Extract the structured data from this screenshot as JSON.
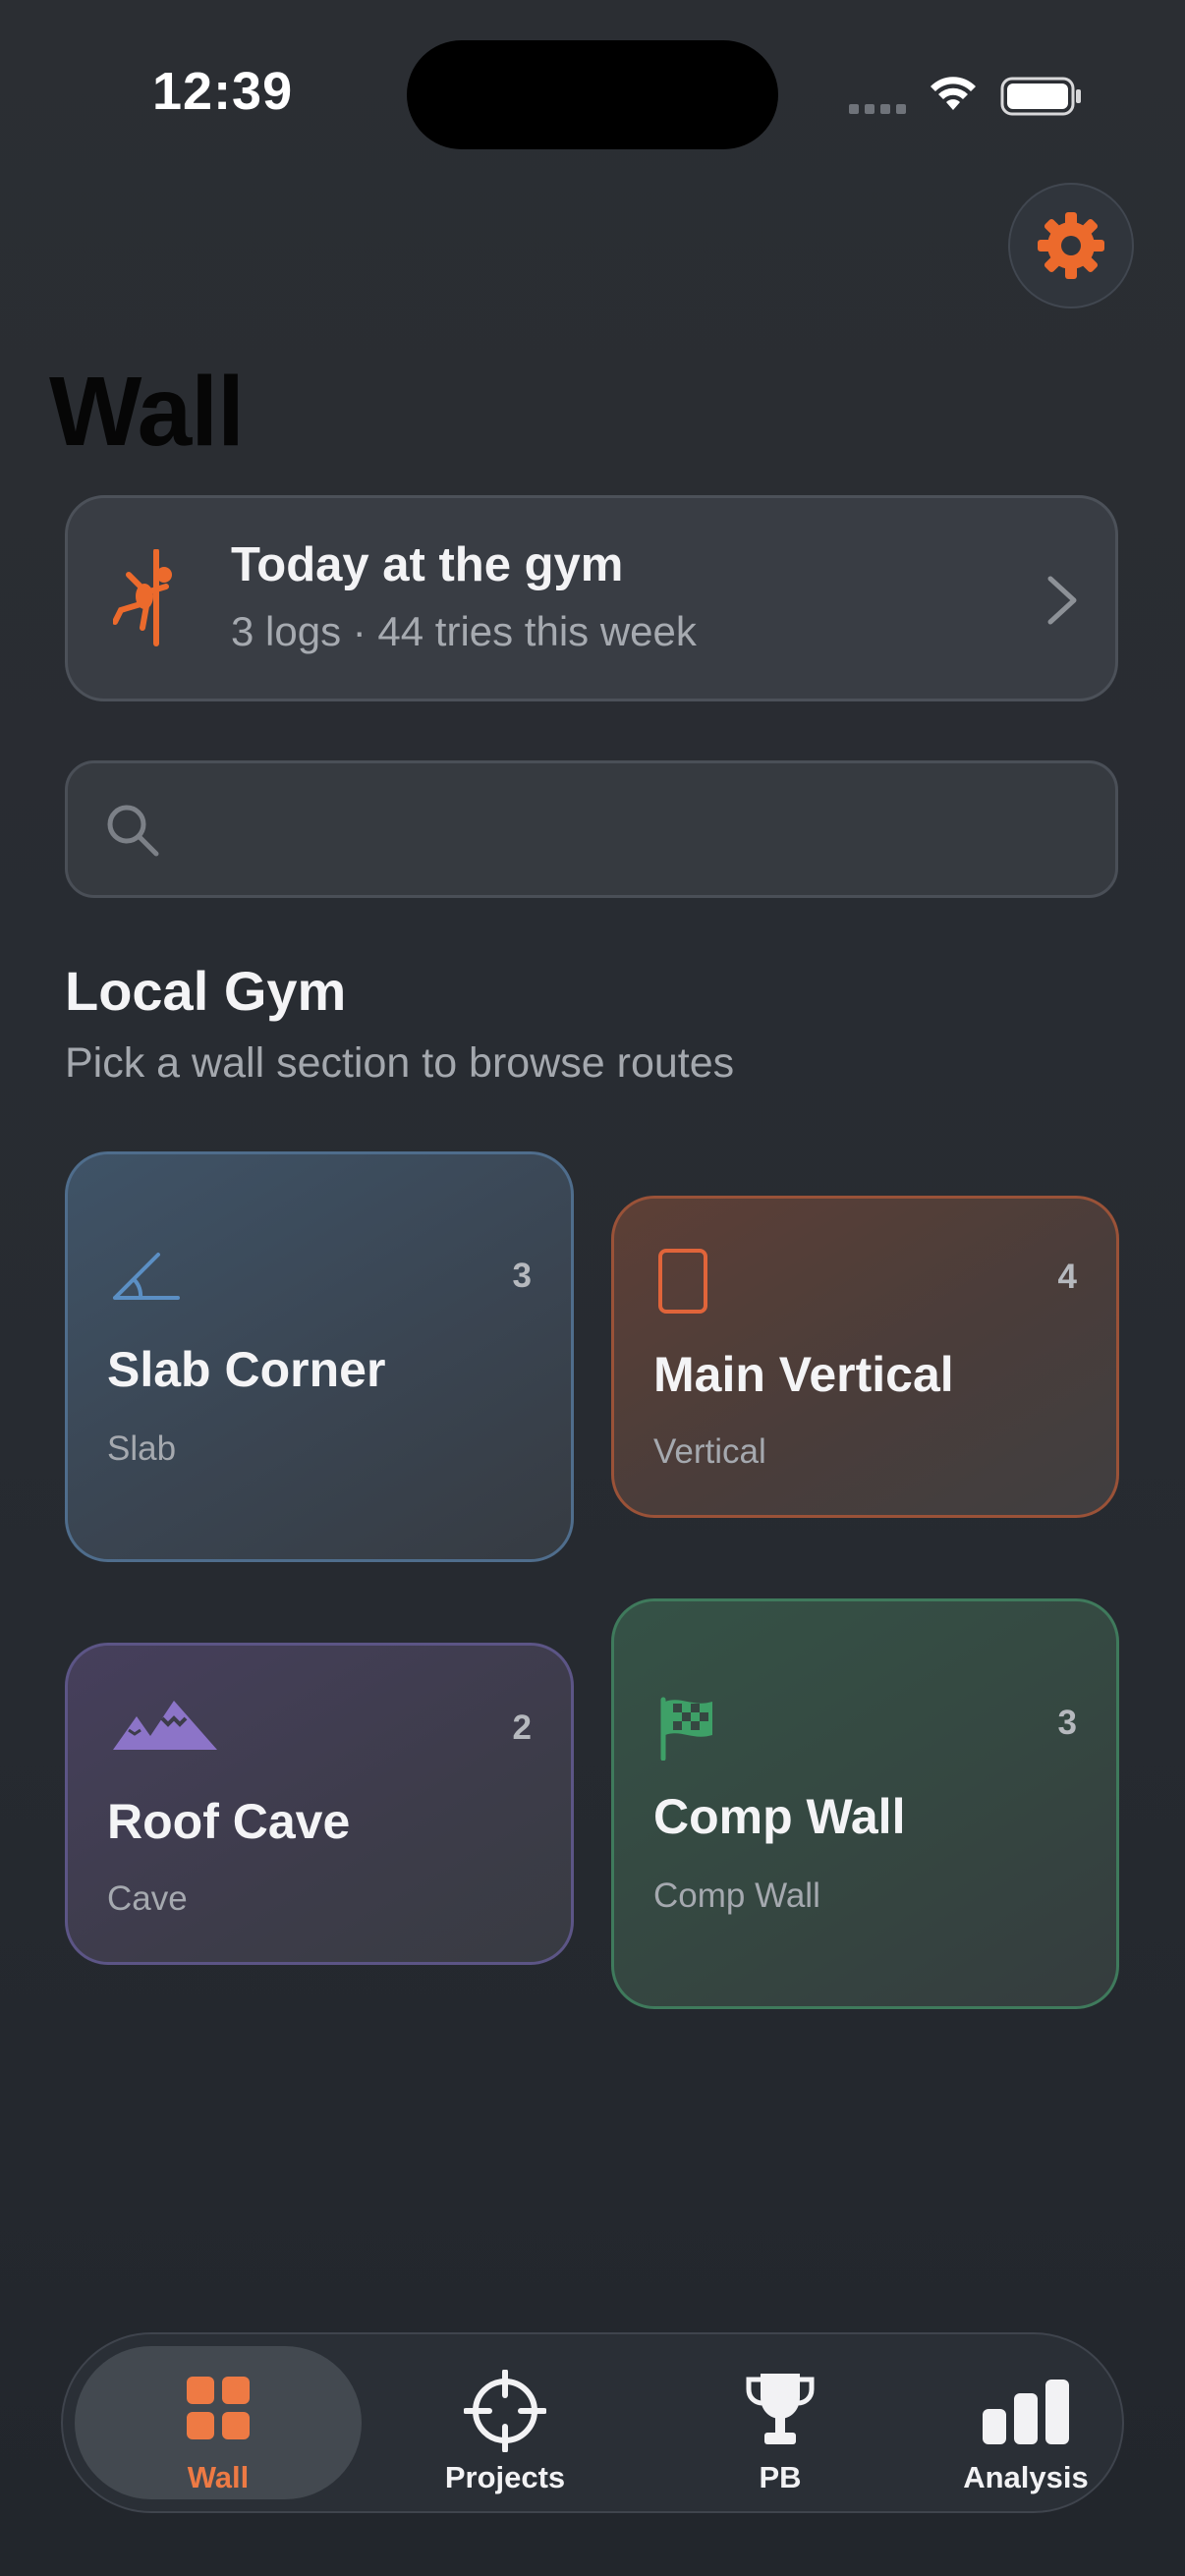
{
  "status_bar": {
    "time": "12:39"
  },
  "settings": {
    "icon": "gear-icon",
    "color": "#ec6a2c"
  },
  "page": {
    "title": "Wall"
  },
  "today_card": {
    "icon": "climber-icon",
    "title": "Today at the gym",
    "subtitle": "3 logs · 44 tries this week"
  },
  "search": {
    "placeholder": "",
    "value": ""
  },
  "gym": {
    "name": "Local Gym",
    "subtitle": "Pick a wall section to browse routes"
  },
  "walls": [
    {
      "name": "Slab Corner",
      "type": "Slab",
      "count": "3",
      "icon": "angle-icon",
      "accent": "#5b8fc4"
    },
    {
      "name": "Main Vertical",
      "type": "Vertical",
      "count": "4",
      "icon": "rectangle-icon",
      "accent": "#e0643a"
    },
    {
      "name": "Roof Cave",
      "type": "Cave",
      "count": "2",
      "icon": "mountains-icon",
      "accent": "#8c74c8"
    },
    {
      "name": "Comp Wall",
      "type": "Comp Wall",
      "count": "3",
      "icon": "checkered-flag-icon",
      "accent": "#3ea067"
    }
  ],
  "tabs": [
    {
      "label": "Wall",
      "icon": "grid-icon",
      "active": true
    },
    {
      "label": "Projects",
      "icon": "crosshair-icon",
      "active": false
    },
    {
      "label": "PB",
      "icon": "trophy-icon",
      "active": false
    },
    {
      "label": "Analysis",
      "icon": "bar-chart-icon",
      "active": false
    }
  ],
  "colors": {
    "accent": "#ee7a44",
    "background": "#292c32"
  }
}
